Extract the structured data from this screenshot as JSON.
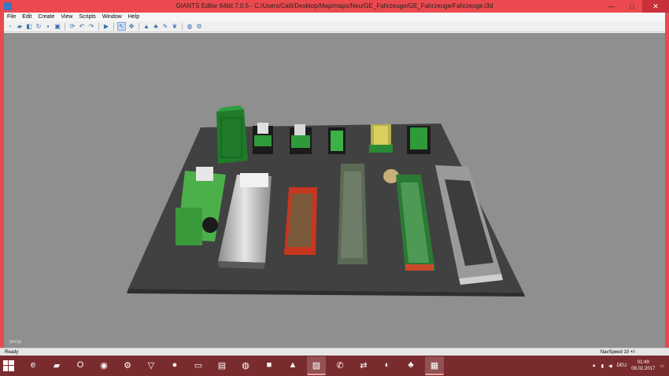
{
  "window": {
    "title": "GIANTS Editor 64bit 7.0.5 - C:/Users/Calli/Desktop/Map/maps/Neu/GE_Fahrzeuge/GE_Fahrzeuge/Fahrzeuge.i3d",
    "minimize": "—",
    "maximize": "□",
    "close": "✕"
  },
  "menu": [
    "File",
    "Edit",
    "Create",
    "View",
    "Scripts",
    "Window",
    "Help"
  ],
  "viewport": {
    "camera_label": "persp"
  },
  "status": {
    "left": "Ready",
    "right": "NavSpeed 10 +/-"
  },
  "taskbar": {
    "tasks": [
      {
        "icon": "ie-icon",
        "glyph": "e"
      },
      {
        "icon": "folder-icon",
        "glyph": "▰"
      },
      {
        "icon": "opera-icon",
        "glyph": "O"
      },
      {
        "icon": "media-icon",
        "glyph": "◉"
      },
      {
        "icon": "steam-icon",
        "glyph": "⚙"
      },
      {
        "icon": "v-app-icon",
        "glyph": "▽"
      },
      {
        "icon": "record-icon",
        "glyph": "●"
      },
      {
        "icon": "monitor-icon",
        "glyph": "▭"
      },
      {
        "icon": "screen-icon",
        "glyph": "▤"
      },
      {
        "icon": "gray-app-icon",
        "glyph": "◍"
      },
      {
        "icon": "minecraft-icon",
        "glyph": "■"
      },
      {
        "icon": "vlc-icon",
        "glyph": "▲"
      },
      {
        "icon": "sticky-icon",
        "glyph": "▨"
      },
      {
        "icon": "whatsapp-icon",
        "glyph": "✆"
      },
      {
        "icon": "teamviewer-icon",
        "glyph": "⇄"
      },
      {
        "icon": "obs-icon",
        "glyph": "◐"
      },
      {
        "icon": "plant-app-icon",
        "glyph": "♣"
      },
      {
        "icon": "giants-editor-icon",
        "glyph": "▦"
      }
    ],
    "language": "DEU",
    "time": "01:49",
    "date": "08.02.2017"
  }
}
